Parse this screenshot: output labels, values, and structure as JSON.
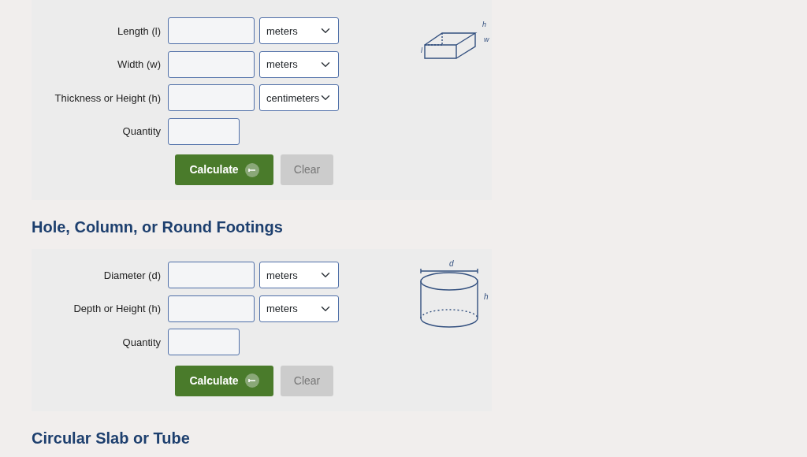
{
  "sections": [
    {
      "fields": [
        {
          "label": "Length (l)",
          "unit": "meters"
        },
        {
          "label": "Width (w)",
          "unit": "meters"
        },
        {
          "label": "Thickness or Height (h)",
          "unit": "centimeters"
        }
      ],
      "quantity_label": "Quantity",
      "buttons": [
        {
          "kind": "calculate",
          "label": "Calculate"
        },
        {
          "kind": "clear",
          "label": "Clear"
        }
      ],
      "diagram": {
        "kind": "box",
        "labels": [
          "h",
          "w",
          "l"
        ]
      }
    },
    {
      "heading": "Hole, Column, or Round Footings",
      "fields": [
        {
          "label": "Diameter (d)",
          "unit": "meters"
        },
        {
          "label": "Depth or Height (h)",
          "unit": "meters"
        }
      ],
      "quantity_label": "Quantity",
      "buttons": [
        {
          "kind": "calculate",
          "label": "Calculate"
        },
        {
          "kind": "clear",
          "label": "Clear"
        }
      ],
      "diagram": {
        "kind": "cylinder",
        "labels": [
          "d",
          "h"
        ]
      }
    },
    {
      "heading": "Circular Slab or Tube"
    }
  ]
}
